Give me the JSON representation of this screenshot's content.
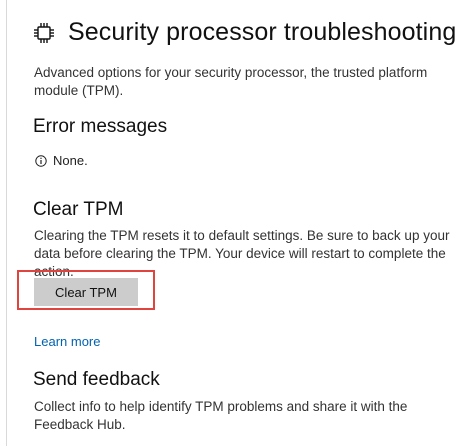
{
  "header": {
    "title": "Security processor troubleshooting",
    "icon": "chip-icon"
  },
  "description": "Advanced options for your security processor, the trusted platform module (TPM).",
  "error_section": {
    "heading": "Error messages",
    "message": "None.",
    "icon": "info-icon"
  },
  "clear_section": {
    "heading": "Clear TPM",
    "description": "Clearing the TPM resets it to default settings. Be sure to back up your data before clearing the TPM. Your device will restart to complete the action.",
    "button_label": "Clear TPM",
    "highlight_color": "#e0443e"
  },
  "learn_more": {
    "label": "Learn more",
    "color": "#0063b1"
  },
  "feedback_section": {
    "heading": "Send feedback",
    "description": "Collect info to help identify TPM problems and share it with the Feedback Hub."
  }
}
